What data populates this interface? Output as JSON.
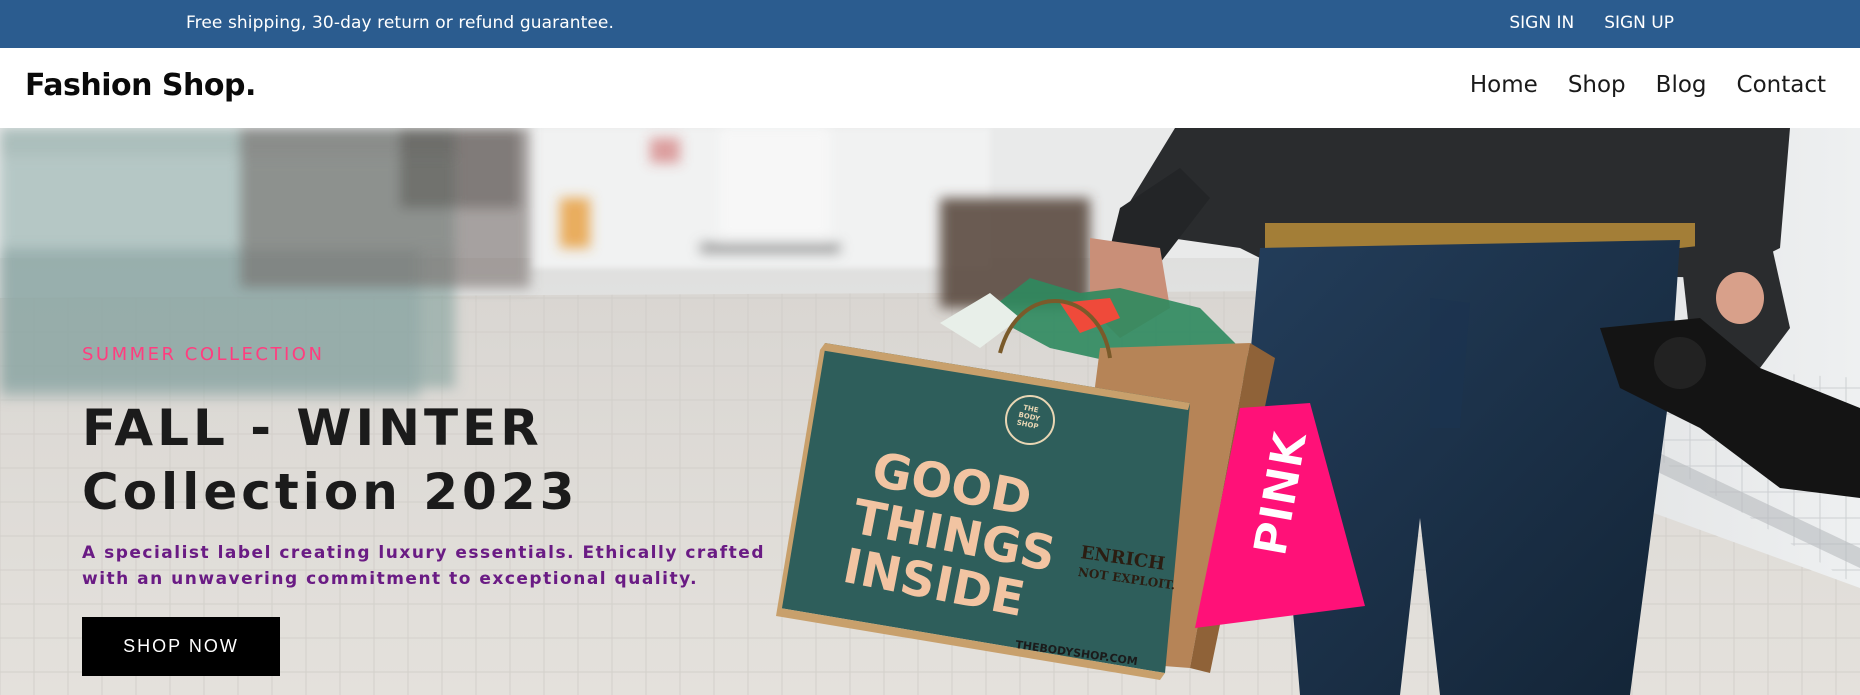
{
  "topbar": {
    "notice": "Free shipping, 30-day return or refund guarantee.",
    "sign_in": "SIGN IN",
    "sign_up": "SIGN UP",
    "background": "#2b5c8f"
  },
  "header": {
    "logo": "Fashion Shop.",
    "nav": [
      "Home",
      "Shop",
      "Blog",
      "Contact"
    ]
  },
  "hero": {
    "eyebrow": "SUMMER COLLECTION",
    "title_line1": "FALL - WINTER",
    "title_line2": "Collection 2023",
    "description_line1": "A specialist label creating luxury essentials. Ethically crafted",
    "description_line2": "with an unwavering commitment to exceptional quality.",
    "cta_label": "SHOP NOW",
    "eyebrow_color": "#ff3d7f",
    "description_color": "#6a1b84",
    "image": {
      "bag_green_text": [
        "GOOD",
        "THINGS",
        "INSIDE"
      ],
      "bag_green_logo": [
        "THE",
        "BODY",
        "SHOP"
      ],
      "bag_green_footer": "THEBODYSHOP.COM",
      "bag_kraft_text": [
        "ENRICH",
        "NOT EXPLOIT."
      ],
      "bag_pink_text": "PINK"
    }
  }
}
